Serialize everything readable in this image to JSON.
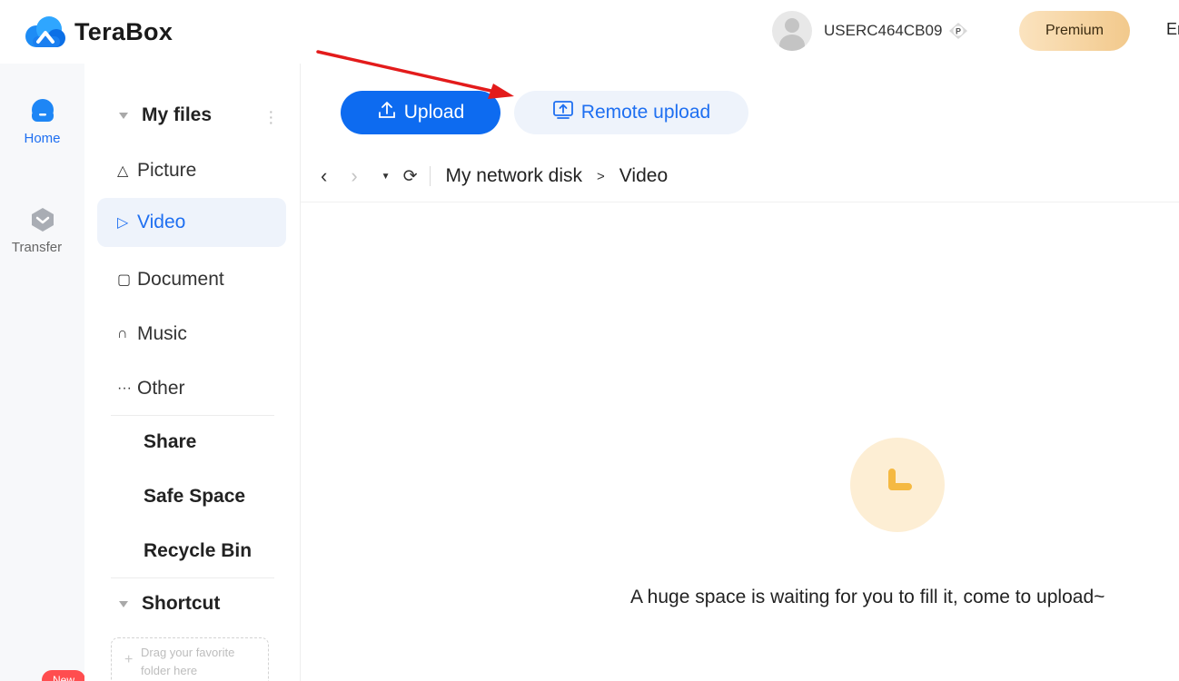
{
  "app": {
    "name": "TeraBox"
  },
  "header": {
    "username": "USERC464CB09",
    "premium_label": "Premium",
    "language_label": "Er"
  },
  "rail": {
    "items": [
      {
        "label": "Home",
        "icon": "cloud-home-icon"
      },
      {
        "label": "Transfer",
        "icon": "transfer-icon"
      }
    ],
    "new_badge": "New"
  },
  "sidebar": {
    "my_files": "My files",
    "items": [
      {
        "label": "Picture",
        "icon": "picture-icon"
      },
      {
        "label": "Video",
        "icon": "play-icon"
      },
      {
        "label": "Document",
        "icon": "document-icon"
      },
      {
        "label": "Music",
        "icon": "headphones-icon"
      },
      {
        "label": "Other",
        "icon": "more-icon"
      }
    ],
    "share": "Share",
    "safe_space": "Safe Space",
    "recycle_bin": "Recycle Bin",
    "shortcut": "Shortcut",
    "drop_hint_line1": "Drag your favorite",
    "drop_hint_line2": "folder here"
  },
  "toolbar": {
    "upload_label": "Upload",
    "remote_upload_label": "Remote upload"
  },
  "breadcrumb": {
    "root": "My network disk",
    "separator": ">",
    "current": "Video"
  },
  "empty_state": {
    "message": "A huge space is waiting for you to fill it, come to upload~"
  },
  "colors": {
    "accent": "#0d6bf0",
    "accent_light": "#eef3fb",
    "premium_gradient_start": "#fbe3bf",
    "premium_gradient_end": "#f2c98c",
    "annotation_arrow": "#e31b1b",
    "empty_icon_bg": "#fdeed4",
    "empty_icon_fg": "#f5b942"
  }
}
